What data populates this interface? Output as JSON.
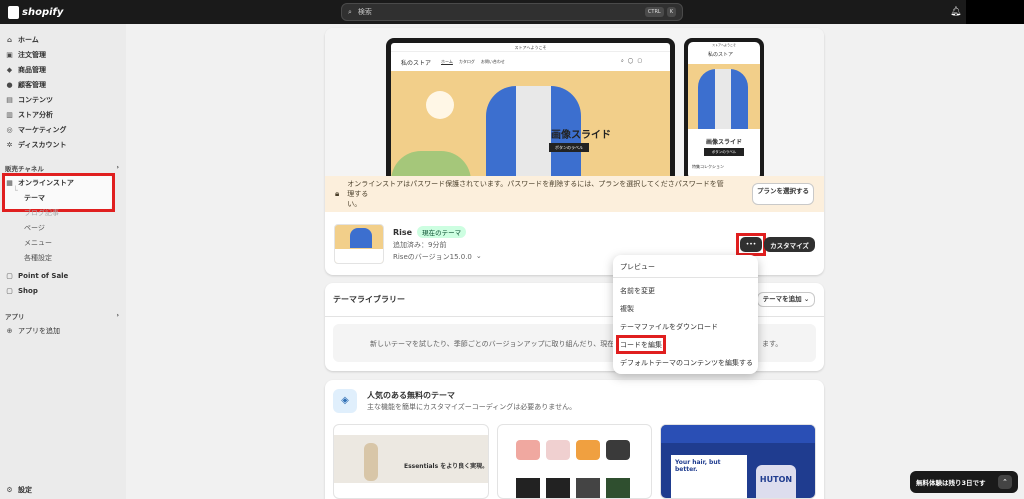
{
  "topbar": {
    "brand": "shopify",
    "search_placeholder": "検索",
    "kbd1": "CTRL",
    "kbd2": "K"
  },
  "sidebar": {
    "items": [
      "ホーム",
      "注文管理",
      "商品管理",
      "顧客管理",
      "コンテンツ",
      "ストア分析",
      "マーケティング",
      "ディスカウント"
    ],
    "sales_channels": "販売チャネル",
    "online_store": "オンラインストア",
    "theme": "テーマ",
    "blog": "ブログ記事",
    "pages": "ページ",
    "menu": "メニュー",
    "settings_sub": "各種設定",
    "pos": "Point of Sale",
    "shop": "Shop",
    "apps": "アプリ",
    "add_app": "アプリを追加",
    "settings": "設定"
  },
  "preview": {
    "announcement": "ストアへようこそ",
    "store_name": "私のストア",
    "nav": [
      "ホーム",
      "カタログ",
      "お問い合わせ"
    ],
    "slide_title": "画像スライド",
    "slide_button": "ボタンのラベル",
    "featured": "特集コレクション"
  },
  "banner": {
    "text": "オンラインストアはパスワード保護されています。パスワードを削除するには、プランを選択してくださ",
    "text2": "い。",
    "link": "パスワードを管理する",
    "button": "プランを選択する"
  },
  "theme": {
    "name": "Rise",
    "badge": "現在のテーマ",
    "added": "追加済み：9分前",
    "version": "Riseのバージョン15.0.0",
    "more": "•••",
    "customize": "カスタマイズ"
  },
  "menu": {
    "items": [
      "プレビュー",
      "名前を変更",
      "複製",
      "テーマファイルをダウンロード",
      "コードを編集",
      "デフォルトテーマのコンテンツを編集する"
    ]
  },
  "library": {
    "title": "テーマライブラリー",
    "add": "テーマを追加",
    "empty_text": "新しいテーマを試したり、季節ごとのバージョンアップに取り組んだり、現在",
    "empty_tail": "ます。"
  },
  "free": {
    "title": "人気のある無料のテーマ",
    "subtitle": "主な機能を簡単にカスタマイズーコーディングは必要ありません。",
    "thumb1_text": "Essentials をより良く実現。",
    "thumb3_text": "Your hair, but better.",
    "thumb3_brand": "HUTON"
  },
  "trial": {
    "text": "無料体験は残り3日です"
  },
  "colors": {
    "highlight": "#e01f1f",
    "topbar": "#1a1a1a",
    "badge": "#cdfee1"
  }
}
